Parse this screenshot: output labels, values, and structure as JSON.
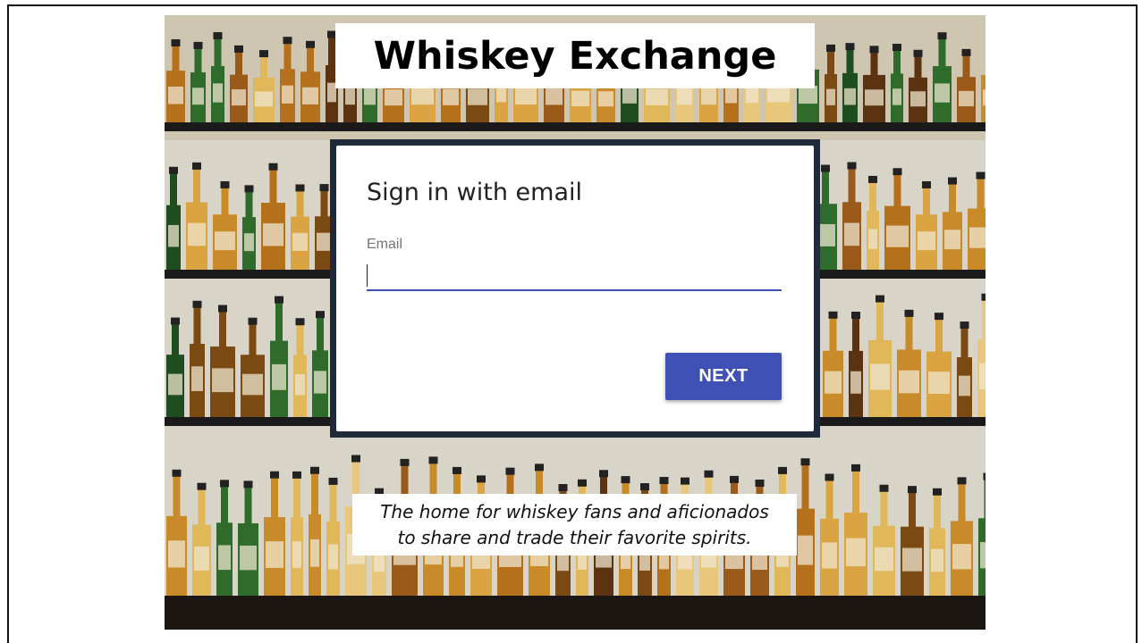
{
  "app": {
    "title": "Whiskey Exchange",
    "tagline": "The home for whiskey fans and aficionados to share and trade their favorite spirits."
  },
  "signin": {
    "heading": "Sign in with email",
    "email_label": "Email",
    "email_value": "",
    "next_label": "NEXT"
  },
  "colors": {
    "accent": "#3f51b5",
    "card_border": "#1f2a3a",
    "background_image": "whiskey-bottle-shelves"
  }
}
